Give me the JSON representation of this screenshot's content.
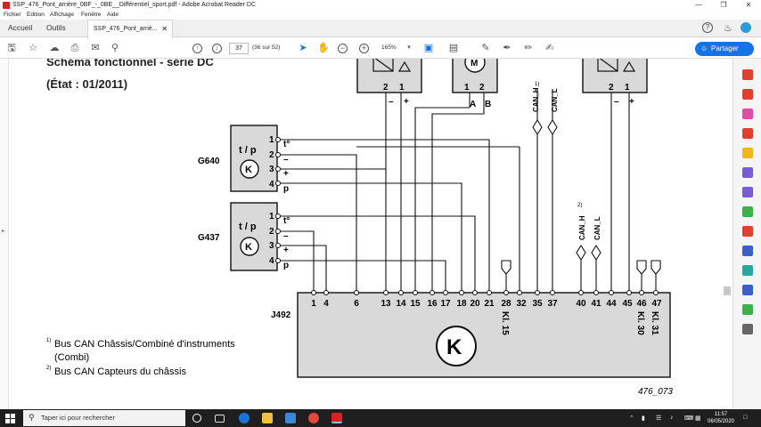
{
  "window": {
    "title": "SSP_476_Pont_arrière_0BF_-_0BE__Différentiel_sport.pdf - Adobe Acrobat Reader DC"
  },
  "menu": [
    "Fichier",
    "Edition",
    "Affichage",
    "Fenêtre",
    "Aide"
  ],
  "tabs": {
    "home": "Accueil",
    "tools": "Outils",
    "document": "SSP_476_Pont_arriè..."
  },
  "toolbar": {
    "page_current": "37",
    "page_info": "(36 sur 52)",
    "zoom": "165%",
    "share_label": "Partager"
  },
  "doc": {
    "heading_partial": "Schéma fonctionnel - série DC",
    "state": "(État : 01/2011)",
    "g640": "G640",
    "g437": "G437",
    "j492": "J492",
    "tp": "t / p",
    "note1": "Bus CAN Châssis/Combiné d'instruments",
    "note1b": "(Combi)",
    "note2": "Bus CAN Capteurs du châssis",
    "sup1": "1)",
    "sup2": "2)",
    "figure_id": "476_073",
    "sensor_pins": [
      "1",
      "2",
      "3",
      "4"
    ],
    "sensor_symbols": [
      "t°",
      "–",
      "+",
      "p"
    ],
    "pins": [
      "1",
      "4",
      "6",
      "13",
      "14",
      "15",
      "16",
      "17",
      "18",
      "20",
      "21",
      "28",
      "32",
      "35",
      "37",
      "40",
      "41",
      "44",
      "45",
      "46",
      "47"
    ],
    "top_left_pins": [
      "2",
      "1"
    ],
    "top_left_signs": [
      "–",
      "+"
    ],
    "top_mid_pins": [
      "1",
      "2"
    ],
    "top_mid_letters": [
      "A",
      "B"
    ],
    "top_right_pins": [
      "2",
      "1"
    ],
    "top_right_signs": [
      "–",
      "+"
    ],
    "can_h": "CAN_H",
    "can_l": "CAN_L",
    "kl15": "Kl. 15",
    "kl30": "Kl. 30",
    "kl31": "Kl. 31"
  },
  "taskbar": {
    "search_placeholder": "Taper ici pour rechercher",
    "time": "11:57",
    "date": "06/05/2020"
  }
}
